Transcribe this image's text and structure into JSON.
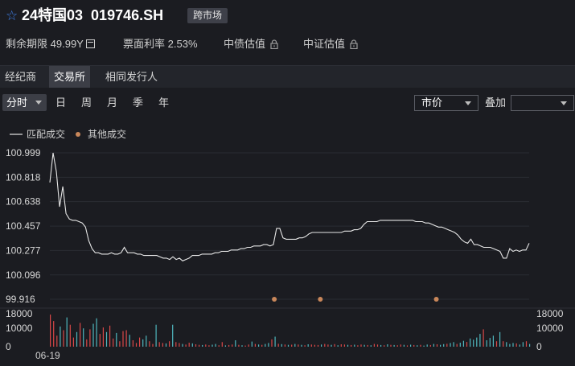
{
  "header": {
    "name": "24特国03",
    "code": "019746.SH",
    "market_badge": "跨市场"
  },
  "info": {
    "remaining_term_label": "剩余期限",
    "remaining_term_value": "49.99Y",
    "coupon_label": "票面利率",
    "coupon_value": "2.53%",
    "cbond_valuation": "中债估值",
    "csi_valuation": "中证估值"
  },
  "tabs": [
    "经纪商",
    "交易所",
    "相同发行人"
  ],
  "toolbar": {
    "period_selected": "分时",
    "periods": [
      "日",
      "周",
      "月",
      "季",
      "年"
    ],
    "price_type": "市价",
    "overlay_label": "叠加",
    "overlay_value": ""
  },
  "colors": {
    "background": "#1b1c21",
    "price_line": "#e6e6e6",
    "other_trade_dot": "#c9875a",
    "volume_up": "#d94848",
    "volume_down": "#4fb6bd",
    "active_tab": "#3c3e46",
    "favorite_star": "#3f7fe6"
  },
  "icons": {
    "favorite": "star-icon",
    "remaining_term": "calendar-icon",
    "valuation": "lock-icon"
  },
  "chart_data": {
    "type": "line",
    "legend": [
      {
        "name": "匹配成交",
        "style": "line"
      },
      {
        "name": "其他成交",
        "style": "dot"
      }
    ],
    "price_axis": {
      "ticks": [
        "100.999",
        "100.818",
        "100.638",
        "100.457",
        "100.277",
        "100.096",
        "99.916"
      ],
      "ylim": [
        99.916,
        100.999
      ]
    },
    "price_series": {
      "name": "匹配成交",
      "values": [
        100.78,
        100.999,
        100.86,
        100.6,
        100.75,
        100.55,
        100.51,
        100.5,
        100.5,
        100.49,
        100.48,
        100.45,
        100.35,
        100.29,
        100.26,
        100.26,
        100.25,
        100.25,
        100.25,
        100.26,
        100.25,
        100.25,
        100.26,
        100.3,
        100.26,
        100.26,
        100.26,
        100.25,
        100.25,
        100.24,
        100.24,
        100.24,
        100.24,
        100.24,
        100.23,
        100.22,
        100.22,
        100.21,
        100.23,
        100.21,
        100.22,
        100.2,
        100.21,
        100.22,
        100.24,
        100.24,
        100.24,
        100.25,
        100.25,
        100.25,
        100.25,
        100.26,
        100.26,
        100.27,
        100.27,
        100.27,
        100.28,
        100.28,
        100.28,
        100.29,
        100.29,
        100.3,
        100.3,
        100.31,
        100.31,
        100.31,
        100.32,
        100.32,
        100.31,
        100.32,
        100.44,
        100.44,
        100.37,
        100.36,
        100.36,
        100.36,
        100.36,
        100.37,
        100.37,
        100.38,
        100.4,
        100.41,
        100.41,
        100.41,
        100.41,
        100.41,
        100.41,
        100.41,
        100.41,
        100.41,
        100.41,
        100.42,
        100.42,
        100.42,
        100.43,
        100.43,
        100.44,
        100.47,
        100.49,
        100.49,
        100.49,
        100.49,
        100.5,
        100.5,
        100.5,
        100.5,
        100.5,
        100.5,
        100.5,
        100.5,
        100.5,
        100.5,
        100.5,
        100.49,
        100.49,
        100.49,
        100.48,
        100.48,
        100.47,
        100.46,
        100.45,
        100.45,
        100.44,
        100.43,
        100.42,
        100.41,
        100.39,
        100.36,
        100.34,
        100.33,
        100.36,
        100.32,
        100.32,
        100.31,
        100.3,
        100.3,
        100.3,
        100.29,
        100.28,
        100.27,
        100.22,
        100.22,
        100.29,
        100.27,
        100.28,
        100.27,
        100.28,
        100.28,
        100.33
      ]
    },
    "other_trades": [
      {
        "x_fraction": 0.475,
        "value": 99.916
      },
      {
        "x_fraction": 0.571,
        "value": 99.916
      },
      {
        "x_fraction": 0.813,
        "value": 99.916
      }
    ],
    "volume_axis": {
      "ticks": [
        "18000",
        "10000",
        "0"
      ],
      "ylim": [
        0,
        18000
      ]
    },
    "volume_series": {
      "values": [
        17500,
        14000,
        6000,
        11000,
        9000,
        16000,
        12000,
        5000,
        8000,
        13000,
        10000,
        4000,
        9500,
        12500,
        15500,
        7000,
        10500,
        8000,
        11500,
        4500,
        7500,
        3000,
        8500,
        9000,
        6500,
        3500,
        2000,
        5000,
        4000,
        6000,
        3000,
        1500,
        12000,
        2500,
        2000,
        1800,
        3000,
        12000,
        2500,
        2000,
        1500,
        1200,
        2200,
        1800,
        1300,
        1000,
        900,
        1200,
        800,
        1100,
        1500,
        800,
        2500,
        700,
        900,
        1200,
        3500,
        1000,
        800,
        600,
        1200,
        2800,
        1500,
        1200,
        1000,
        1500,
        2000,
        4000,
        5500,
        1600,
        1400,
        1200,
        1000,
        1100,
        1500,
        1200,
        1000,
        800,
        1300,
        1200,
        1000,
        900,
        1200,
        1500,
        1200,
        1000,
        1400,
        800,
        1300,
        1200,
        1000,
        900,
        1100,
        800,
        1200,
        1000,
        900,
        800,
        1500,
        1200,
        900,
        800,
        1300,
        1000,
        900,
        800,
        1200,
        1000,
        700,
        1100,
        900,
        800,
        1000,
        600,
        1200,
        900,
        1500,
        1300,
        1000,
        1400,
        1600,
        2000,
        2500,
        1500,
        2200,
        3200,
        2600,
        4500,
        3800,
        5000,
        7000,
        9500,
        3500,
        4800,
        6000,
        3000,
        8000,
        3000,
        2500,
        1500,
        2000,
        1800,
        1200,
        2500,
        3000,
        1500
      ],
      "up": [
        true,
        true,
        true,
        false,
        true,
        false,
        true,
        true,
        false,
        true,
        false,
        true,
        true,
        false,
        false,
        true,
        true,
        false,
        true,
        true,
        false,
        true,
        true,
        true,
        false,
        true,
        true,
        true,
        false,
        false,
        true,
        true,
        false,
        true,
        true,
        false,
        true,
        false,
        true,
        true,
        false,
        true,
        true,
        false,
        true,
        true,
        false,
        true,
        true,
        false,
        false,
        true,
        true,
        false,
        true,
        true,
        false,
        true,
        false,
        true,
        true,
        false,
        true,
        false,
        true,
        false,
        false,
        true,
        false,
        true,
        false,
        true,
        false,
        true,
        false,
        true,
        false,
        true,
        false,
        true,
        true,
        true,
        false,
        true,
        true,
        false,
        true,
        false,
        true,
        true,
        false,
        true,
        false,
        true,
        true,
        false,
        true,
        false,
        true,
        true,
        false,
        true,
        false,
        true,
        false,
        true,
        true,
        false,
        true,
        false,
        true,
        false,
        true,
        false,
        false,
        true,
        false,
        true,
        false,
        false,
        true,
        false,
        false,
        true,
        false,
        false,
        true,
        false,
        false,
        false,
        false,
        true,
        false,
        false,
        false,
        true,
        false,
        true,
        false,
        false,
        false,
        true,
        false,
        false,
        true,
        false,
        false
      ]
    },
    "x_axis": {
      "start_label": "06-19"
    }
  }
}
